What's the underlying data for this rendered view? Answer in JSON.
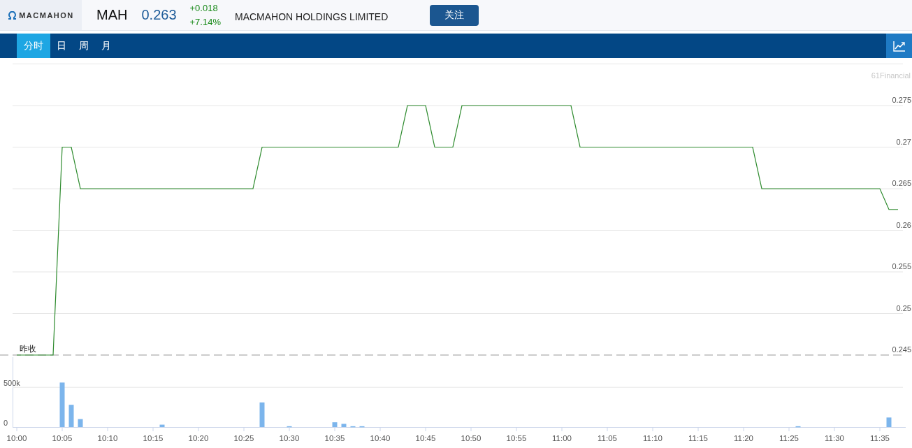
{
  "header": {
    "logo": "MACMAHON",
    "symbol": "MAH",
    "price": "0.263",
    "change": "+0.018",
    "change_pct": "+7.14%",
    "company": "MACMAHON HOLDINGS LIMITED",
    "follow_button": "关注"
  },
  "tabs": [
    {
      "label": "分时",
      "selected": true
    },
    {
      "label": "日",
      "selected": false
    },
    {
      "label": "周",
      "selected": false
    },
    {
      "label": "月",
      "selected": false
    }
  ],
  "price_chart": {
    "credit": "61Financial",
    "prev_close_label": "昨收",
    "chart_data": {
      "type": "line",
      "grid": true,
      "categories": [
        null,
        null,
        null,
        null,
        null,
        null,
        null,
        null,
        null,
        null,
        null,
        null,
        null,
        null,
        null,
        null,
        null,
        null,
        null,
        null,
        null,
        null,
        null,
        null,
        null,
        null,
        null,
        null,
        null,
        null,
        null,
        null,
        null,
        null,
        null,
        null,
        null,
        null,
        null,
        null,
        null,
        null,
        null,
        null,
        null,
        null,
        null,
        null,
        null,
        null,
        null,
        null,
        null,
        null,
        null,
        null,
        null,
        null,
        null,
        null,
        null,
        null,
        null,
        null,
        null,
        null,
        null,
        null,
        null,
        null,
        null,
        null,
        null,
        null,
        null,
        null,
        null,
        null,
        null,
        null,
        null,
        null,
        null,
        null,
        null,
        null,
        null,
        null,
        null,
        null,
        null,
        null,
        null,
        null,
        null,
        null,
        null,
        null
      ],
      "series": [
        {
          "color": "#2e8b2e",
          "values": [
            0.245,
            0.245,
            0.245,
            0.245,
            0.245,
            0.27,
            0.27,
            0.265,
            0.265,
            0.265,
            0.265,
            0.265,
            0.265,
            0.265,
            0.265,
            0.265,
            0.265,
            0.265,
            0.265,
            0.265,
            0.265,
            0.265,
            0.265,
            0.265,
            0.265,
            0.265,
            0.265,
            0.27,
            0.27,
            0.27,
            0.27,
            0.27,
            0.27,
            0.27,
            0.27,
            0.27,
            0.27,
            0.27,
            0.27,
            0.27,
            0.27,
            0.27,
            0.27,
            0.275,
            0.275,
            0.275,
            0.27,
            0.27,
            0.27,
            0.275,
            0.275,
            0.275,
            0.275,
            0.275,
            0.275,
            0.275,
            0.275,
            0.275,
            0.275,
            0.275,
            0.275,
            0.275,
            0.27,
            0.27,
            0.27,
            0.27,
            0.27,
            0.27,
            0.27,
            0.27,
            0.27,
            0.27,
            0.27,
            0.27,
            0.27,
            0.27,
            0.27,
            0.27,
            0.27,
            0.27,
            0.27,
            0.27,
            0.265,
            0.265,
            0.265,
            0.265,
            0.265,
            0.265,
            0.265,
            0.265,
            0.265,
            0.265,
            0.265,
            0.265,
            0.265,
            0.265,
            0.2625,
            0.2625
          ]
        }
      ],
      "ylim": [
        0.245,
        0.28
      ],
      "yticks": [
        {
          "value": 0.245,
          "label": "0.245"
        },
        {
          "value": 0.25,
          "label": "0.25"
        },
        {
          "value": 0.255,
          "label": "0.255"
        },
        {
          "value": 0.26,
          "label": "0.26"
        },
        {
          "value": 0.265,
          "label": "0.265"
        },
        {
          "value": 0.27,
          "label": "0.27"
        },
        {
          "value": 0.275,
          "label": "0.275"
        }
      ]
    }
  },
  "volume_chart": {
    "chart_data": {
      "type": "bar",
      "grid": true,
      "categories": [
        "10:00",
        null,
        null,
        null,
        null,
        "10:05",
        null,
        null,
        null,
        null,
        "10:10",
        null,
        null,
        null,
        null,
        "10:15",
        null,
        null,
        null,
        null,
        "10:20",
        null,
        null,
        null,
        null,
        "10:25",
        null,
        null,
        null,
        null,
        "10:30",
        null,
        null,
        null,
        null,
        "10:35",
        null,
        null,
        null,
        null,
        "10:40",
        null,
        null,
        null,
        null,
        "10:45",
        null,
        null,
        null,
        null,
        "10:50",
        null,
        null,
        null,
        null,
        "10:55",
        null,
        null,
        null,
        null,
        "11:00",
        null,
        null,
        null,
        null,
        "11:05",
        null,
        null,
        null,
        null,
        "11:10",
        null,
        null,
        null,
        null,
        "11:15",
        null,
        null,
        null,
        null,
        "11:20",
        null,
        null,
        null,
        null,
        "11:25",
        null,
        null,
        null,
        null,
        "11:30",
        null,
        null,
        null,
        null,
        "11:35",
        null,
        null
      ],
      "series": [
        {
          "color": "#7cb5ec",
          "values": [
            0,
            0,
            0,
            0,
            0,
            560000,
            280000,
            100000,
            0,
            0,
            0,
            0,
            0,
            0,
            0,
            0,
            30000,
            0,
            0,
            0,
            0,
            0,
            0,
            0,
            0,
            0,
            0,
            310000,
            0,
            0,
            10000,
            0,
            0,
            0,
            0,
            60000,
            40000,
            10000,
            10000,
            0,
            0,
            0,
            0,
            0,
            0,
            0,
            0,
            0,
            0,
            0,
            0,
            0,
            0,
            0,
            0,
            0,
            0,
            0,
            0,
            0,
            0,
            0,
            0,
            0,
            0,
            0,
            0,
            0,
            0,
            0,
            0,
            0,
            0,
            0,
            0,
            0,
            0,
            0,
            0,
            0,
            0,
            0,
            0,
            0,
            0,
            0,
            10000,
            0,
            0,
            0,
            0,
            0,
            0,
            0,
            0,
            0,
            120000,
            0
          ]
        }
      ],
      "ylim": [
        0,
        880000
      ],
      "yticks": [
        {
          "value": 0,
          "label": "0"
        },
        {
          "value": 500000,
          "label": "500k"
        }
      ]
    }
  }
}
